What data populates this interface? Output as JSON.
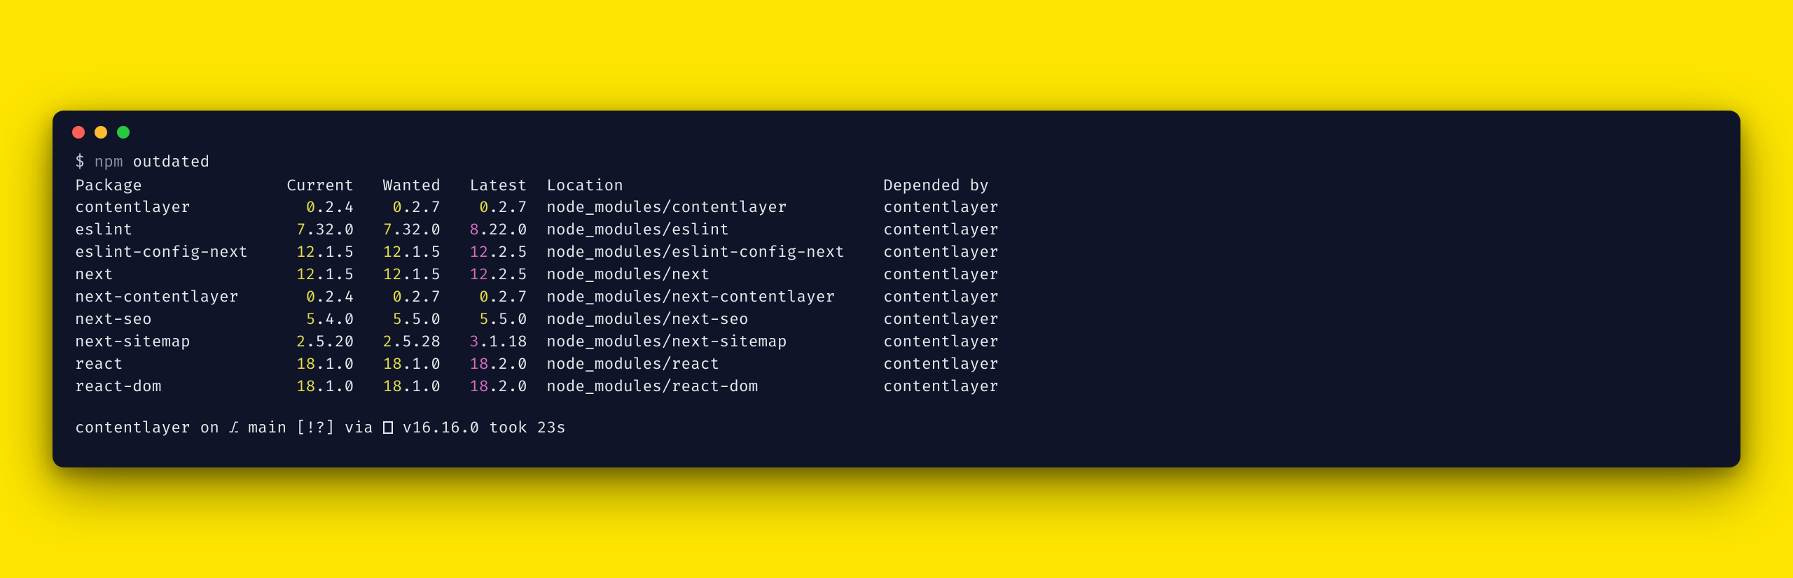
{
  "prompt": {
    "symbol": "$",
    "cmd_dim": "npm",
    "cmd_rest": "outdated"
  },
  "headers": {
    "package": "Package",
    "current": "Current",
    "wanted": "Wanted",
    "latest": "Latest",
    "location": "Location",
    "depended": "Depended by"
  },
  "rows": [
    {
      "pkg": "contentlayer",
      "current": {
        "hi": "0",
        "rest": ".2.4"
      },
      "wanted": {
        "hi": "0",
        "rest": ".2.7"
      },
      "latest": {
        "hi": "0",
        "rest": ".2.7"
      },
      "latest_color": "yellow",
      "location": "node_modules/contentlayer",
      "dep": "contentlayer"
    },
    {
      "pkg": "eslint",
      "current": {
        "hi": "7",
        "rest": ".32.0"
      },
      "wanted": {
        "hi": "7",
        "rest": ".32.0"
      },
      "latest": {
        "hi": "8",
        "rest": ".22.0"
      },
      "latest_color": "magenta",
      "location": "node_modules/eslint",
      "dep": "contentlayer"
    },
    {
      "pkg": "eslint-config-next",
      "current": {
        "hi": "12",
        "rest": ".1.5"
      },
      "wanted": {
        "hi": "12",
        "rest": ".1.5"
      },
      "latest": {
        "hi": "12",
        "rest": ".2.5"
      },
      "latest_color": "magenta",
      "location": "node_modules/eslint-config-next",
      "dep": "contentlayer"
    },
    {
      "pkg": "next",
      "current": {
        "hi": "12",
        "rest": ".1.5"
      },
      "wanted": {
        "hi": "12",
        "rest": ".1.5"
      },
      "latest": {
        "hi": "12",
        "rest": ".2.5"
      },
      "latest_color": "magenta",
      "location": "node_modules/next",
      "dep": "contentlayer"
    },
    {
      "pkg": "next-contentlayer",
      "current": {
        "hi": "0",
        "rest": ".2.4"
      },
      "wanted": {
        "hi": "0",
        "rest": ".2.7"
      },
      "latest": {
        "hi": "0",
        "rest": ".2.7"
      },
      "latest_color": "yellow",
      "location": "node_modules/next-contentlayer",
      "dep": "contentlayer"
    },
    {
      "pkg": "next-seo",
      "current": {
        "hi": "5",
        "rest": ".4.0"
      },
      "wanted": {
        "hi": "5",
        "rest": ".5.0"
      },
      "latest": {
        "hi": "5",
        "rest": ".5.0"
      },
      "latest_color": "yellow",
      "location": "node_modules/next-seo",
      "dep": "contentlayer"
    },
    {
      "pkg": "next-sitemap",
      "current": {
        "hi": "2",
        "rest": ".5.20"
      },
      "wanted": {
        "hi": "2",
        "rest": ".5.28"
      },
      "latest": {
        "hi": "3",
        "rest": ".1.18"
      },
      "latest_color": "magenta",
      "location": "node_modules/next-sitemap",
      "dep": "contentlayer"
    },
    {
      "pkg": "react",
      "current": {
        "hi": "18",
        "rest": ".1.0"
      },
      "wanted": {
        "hi": "18",
        "rest": ".1.0"
      },
      "latest": {
        "hi": "18",
        "rest": ".2.0"
      },
      "latest_color": "magenta",
      "location": "node_modules/react",
      "dep": "contentlayer"
    },
    {
      "pkg": "react-dom",
      "current": {
        "hi": "18",
        "rest": ".1.0"
      },
      "wanted": {
        "hi": "18",
        "rest": ".1.0"
      },
      "latest": {
        "hi": "18",
        "rest": ".2.0"
      },
      "latest_color": "magenta",
      "location": "node_modules/react-dom",
      "dep": "contentlayer"
    }
  ],
  "columns": {
    "package": 20,
    "current": 7,
    "wanted": 7,
    "latest": 7,
    "location": 33
  },
  "status": {
    "project": "contentlayer",
    "on": "on",
    "branch_icon": "⎇",
    "branch": "main",
    "flags": "[!?]",
    "via": "via",
    "node_icon": "▯",
    "node_version": "v16.16.0",
    "took": "took",
    "duration": "23s"
  }
}
